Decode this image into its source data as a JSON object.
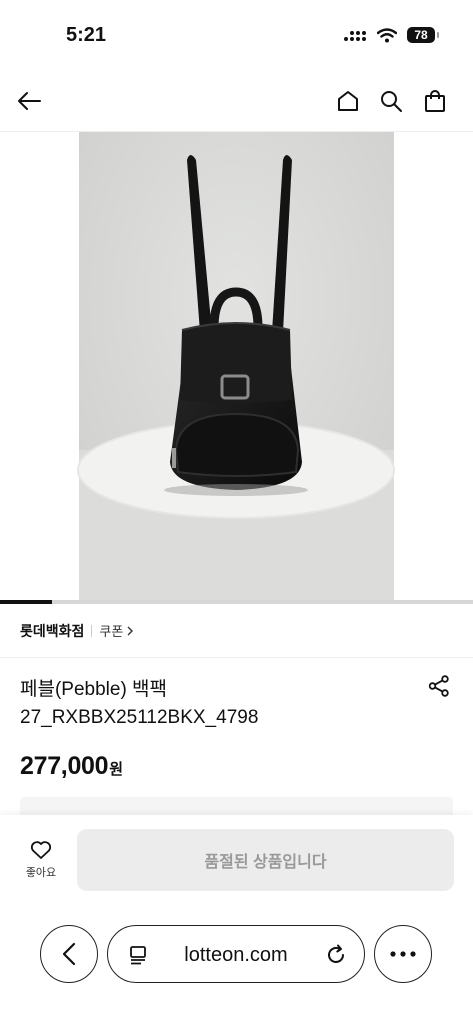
{
  "status_bar": {
    "time": "5:21",
    "battery": "78"
  },
  "header": {
    "back_icon": "arrow-left-icon",
    "home_icon": "home-icon",
    "search_icon": "search-icon",
    "cart_icon": "shopping-bag-icon"
  },
  "gallery": {
    "image_description": "black leather backpack on a white round pedestal",
    "progress": 0.11
  },
  "brand": {
    "name": "롯데백화점",
    "coupon_label": "쿠폰"
  },
  "product": {
    "name_line1": "페블(Pebble) 백팩",
    "name_line2": "27_RXBBX25112BKX_4798",
    "price": "277,000",
    "price_unit": "원"
  },
  "action_bar": {
    "like_label": "좋아요",
    "soldout_label": "품절된 상품입니다"
  },
  "browser": {
    "url": "lotteon.com"
  },
  "colors": {
    "text": "#111111",
    "muted": "#999999",
    "disabled_bg": "#ececec",
    "photo_bg": "#d8d9d7"
  }
}
